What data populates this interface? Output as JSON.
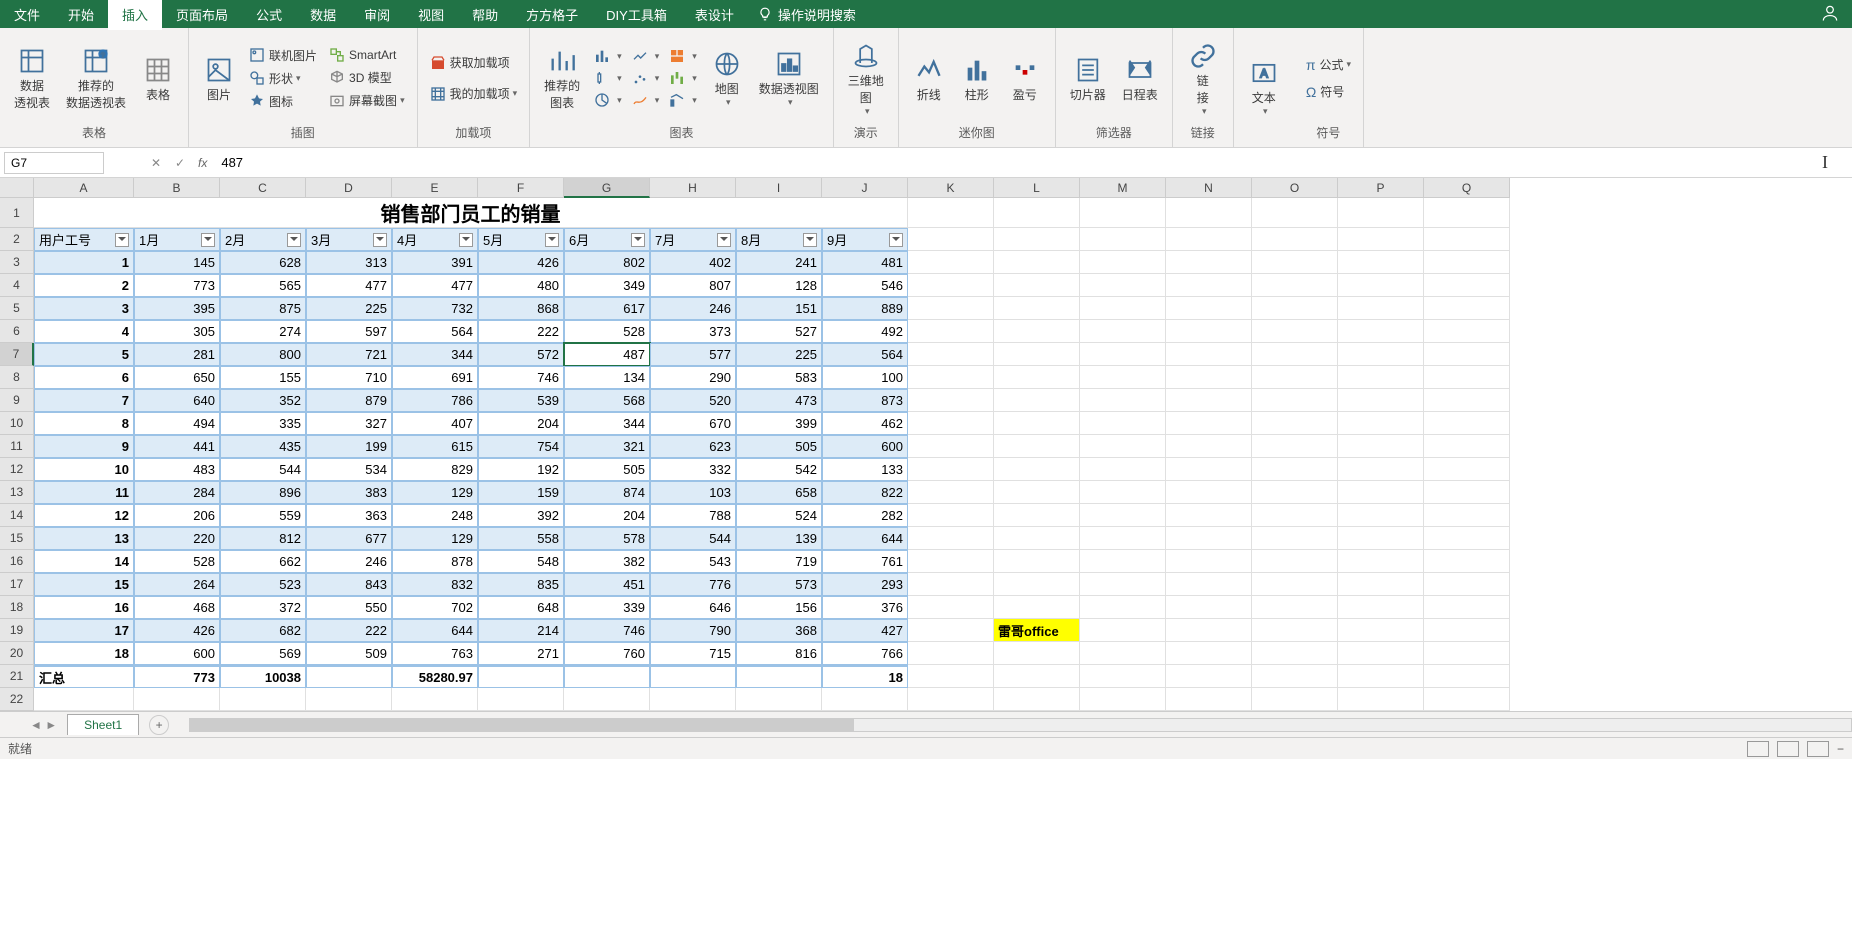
{
  "tabs": [
    "文件",
    "开始",
    "插入",
    "页面布局",
    "公式",
    "数据",
    "审阅",
    "视图",
    "帮助",
    "方方格子",
    "DIY工具箱",
    "表设计"
  ],
  "active_tab_index": 2,
  "tell_me": "操作说明搜索",
  "ribbon": {
    "g_table": {
      "label": "表格",
      "pivot": "数据\n透视表",
      "rec_pivot": "推荐的\n数据透视表",
      "table": "表格"
    },
    "g_illus": {
      "label": "插图",
      "pic": "图片",
      "online": "联机图片",
      "shapes": "形状",
      "icons": "图标",
      "smartart": "SmartArt",
      "model3d": "3D 模型",
      "screenshot": "屏幕截图"
    },
    "g_addin": {
      "label": "加载项",
      "getaddin": "获取加载项",
      "myaddin": "我的加载项"
    },
    "g_charts": {
      "label": "图表",
      "recchart": "推荐的\n图表",
      "map": "地图",
      "pivotchart": "数据透视图"
    },
    "g_demo": {
      "label": "演示",
      "map3d": "三维地\n图"
    },
    "g_spark": {
      "label": "迷你图",
      "line": "折线",
      "col": "柱形",
      "wl": "盈亏"
    },
    "g_filter": {
      "label": "筛选器",
      "slicer": "切片器",
      "timeline": "日程表"
    },
    "g_link": {
      "label": "链接",
      "link": "链\n接"
    },
    "g_text": {
      "label": "",
      "text": "文本"
    },
    "g_symbol": {
      "label": "符号",
      "formula": "公式",
      "symbol": "符号"
    }
  },
  "formula_bar": {
    "cell_ref": "G7",
    "fx": "fx",
    "value": "487"
  },
  "columns": [
    "A",
    "B",
    "C",
    "D",
    "E",
    "F",
    "G",
    "H",
    "I",
    "J",
    "K",
    "L",
    "M",
    "N",
    "O",
    "P",
    "Q"
  ],
  "selected_col_index": 6,
  "selected_row_index": 6,
  "table_title": "销售部门员工的销量",
  "headers": [
    "用户工号",
    "1月",
    "2月",
    "3月",
    "4月",
    "5月",
    "6月",
    "7月",
    "8月",
    "9月"
  ],
  "rows": [
    [
      1,
      145,
      628,
      313,
      391,
      426,
      802,
      402,
      241,
      481
    ],
    [
      2,
      773,
      565,
      477,
      477,
      480,
      349,
      807,
      128,
      546
    ],
    [
      3,
      395,
      875,
      225,
      732,
      868,
      617,
      246,
      151,
      889
    ],
    [
      4,
      305,
      274,
      597,
      564,
      222,
      528,
      373,
      527,
      492
    ],
    [
      5,
      281,
      800,
      721,
      344,
      572,
      487,
      577,
      225,
      564
    ],
    [
      6,
      650,
      155,
      710,
      691,
      746,
      134,
      290,
      583,
      100
    ],
    [
      7,
      640,
      352,
      879,
      786,
      539,
      568,
      520,
      473,
      873
    ],
    [
      8,
      494,
      335,
      327,
      407,
      204,
      344,
      670,
      399,
      462
    ],
    [
      9,
      441,
      435,
      199,
      615,
      754,
      321,
      623,
      505,
      600
    ],
    [
      10,
      483,
      544,
      534,
      829,
      192,
      505,
      332,
      542,
      133
    ],
    [
      11,
      284,
      896,
      383,
      129,
      159,
      874,
      103,
      658,
      822
    ],
    [
      12,
      206,
      559,
      363,
      248,
      392,
      204,
      788,
      524,
      282
    ],
    [
      13,
      220,
      812,
      677,
      129,
      558,
      578,
      544,
      139,
      644
    ],
    [
      14,
      528,
      662,
      246,
      878,
      548,
      382,
      543,
      719,
      761
    ],
    [
      15,
      264,
      523,
      843,
      832,
      835,
      451,
      776,
      573,
      293
    ],
    [
      16,
      468,
      372,
      550,
      702,
      648,
      339,
      646,
      156,
      376
    ],
    [
      17,
      426,
      682,
      222,
      644,
      214,
      746,
      790,
      368,
      427
    ],
    [
      18,
      600,
      569,
      509,
      763,
      271,
      760,
      715,
      816,
      766
    ]
  ],
  "totals_label": "汇总",
  "totals": [
    "",
    773,
    10038,
    "",
    58280.97,
    "",
    "",
    "",
    "",
    18
  ],
  "highlight_text": "雷哥office",
  "sheet_name": "Sheet1",
  "status": "就绪"
}
